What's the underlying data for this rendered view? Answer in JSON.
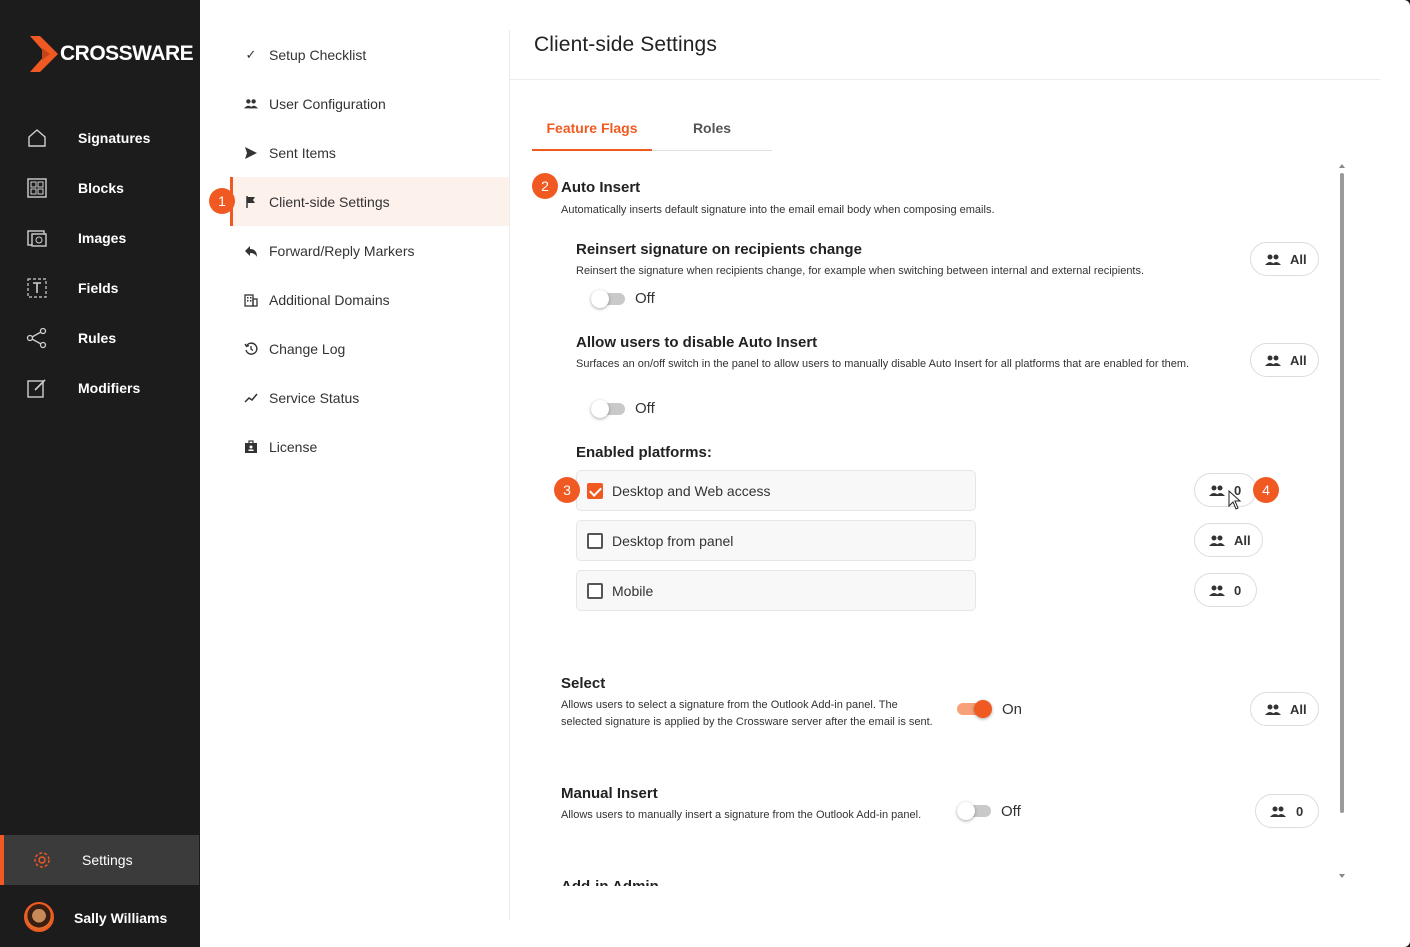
{
  "brand": {
    "name": "CROSSWARE",
    "accent": "#f05a22"
  },
  "nav": {
    "items": [
      {
        "label": "Signatures",
        "icon": "home-icon"
      },
      {
        "label": "Blocks",
        "icon": "blocks-icon"
      },
      {
        "label": "Images",
        "icon": "images-icon"
      },
      {
        "label": "Fields",
        "icon": "fields-icon"
      },
      {
        "label": "Rules",
        "icon": "rules-icon"
      },
      {
        "label": "Modifiers",
        "icon": "modifiers-icon"
      }
    ],
    "settings_label": "Settings",
    "user_name": "Sally Williams"
  },
  "submenu": {
    "items": [
      {
        "label": "Setup Checklist",
        "icon": "check-icon"
      },
      {
        "label": "User Configuration",
        "icon": "users-icon"
      },
      {
        "label": "Sent Items",
        "icon": "send-icon"
      },
      {
        "label": "Client-side Settings",
        "icon": "flag-icon",
        "active": true
      },
      {
        "label": "Forward/Reply Markers",
        "icon": "reply-icon"
      },
      {
        "label": "Additional Domains",
        "icon": "building-icon"
      },
      {
        "label": "Change Log",
        "icon": "history-icon"
      },
      {
        "label": "Service Status",
        "icon": "trend-icon"
      },
      {
        "label": "License",
        "icon": "license-icon"
      }
    ]
  },
  "badges": [
    "1",
    "2",
    "3",
    "4"
  ],
  "page": {
    "title": "Client-side Settings",
    "tabs": [
      {
        "label": "Feature Flags",
        "active": true
      },
      {
        "label": "Roles",
        "active": false
      }
    ]
  },
  "auto_insert": {
    "title": "Auto Insert",
    "description": "Automatically inserts default signature into the email email body when composing emails.",
    "reinsert": {
      "title": "Reinsert signature on recipients change",
      "description": "Reinsert the signature when recipients change, for example when switching between internal and external recipients.",
      "state": "Off",
      "roles": "All"
    },
    "allow_disable": {
      "title": "Allow users to disable Auto Insert",
      "description": "Surfaces an on/off switch in the panel to allow users to manually disable Auto Insert for all platforms that are enabled for them.",
      "state": "Off",
      "roles": "All"
    },
    "platforms_title": "Enabled platforms:",
    "platforms": [
      {
        "label": "Desktop and Web access",
        "checked": true,
        "roles": "0"
      },
      {
        "label": "Desktop from panel",
        "checked": false,
        "roles": "All"
      },
      {
        "label": "Mobile",
        "checked": false,
        "roles": "0"
      }
    ]
  },
  "select": {
    "title": "Select",
    "description": "Allows users to select a signature from the Outlook Add-in panel. The selected signature is applied by the Crossware server after the email is sent.",
    "state": "On",
    "roles": "All"
  },
  "manual_insert": {
    "title": "Manual Insert",
    "description": "Allows users to manually insert a signature from the Outlook Add-in panel.",
    "state": "Off",
    "roles": "0"
  },
  "next_section_partial": "Add-in Admin"
}
